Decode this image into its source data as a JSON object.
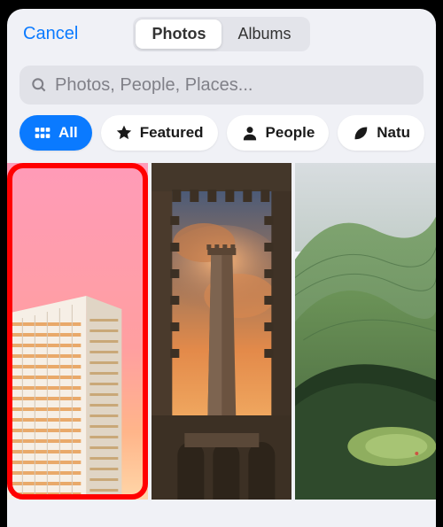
{
  "header": {
    "cancel_label": "Cancel",
    "segments": [
      "Photos",
      "Albums"
    ],
    "active_segment": 0
  },
  "search": {
    "placeholder": "Photos, People, Places..."
  },
  "filters": [
    {
      "label": "All",
      "icon": "grid-icon",
      "active": true
    },
    {
      "label": "Featured",
      "icon": "star-icon",
      "active": false
    },
    {
      "label": "People",
      "icon": "person-icon",
      "active": false
    },
    {
      "label": "Natu",
      "icon": "leaf-icon",
      "active": false
    }
  ],
  "photos": [
    {
      "name": "photo-0",
      "selected": true
    },
    {
      "name": "photo-1",
      "selected": false
    },
    {
      "name": "photo-2",
      "selected": false
    }
  ]
}
